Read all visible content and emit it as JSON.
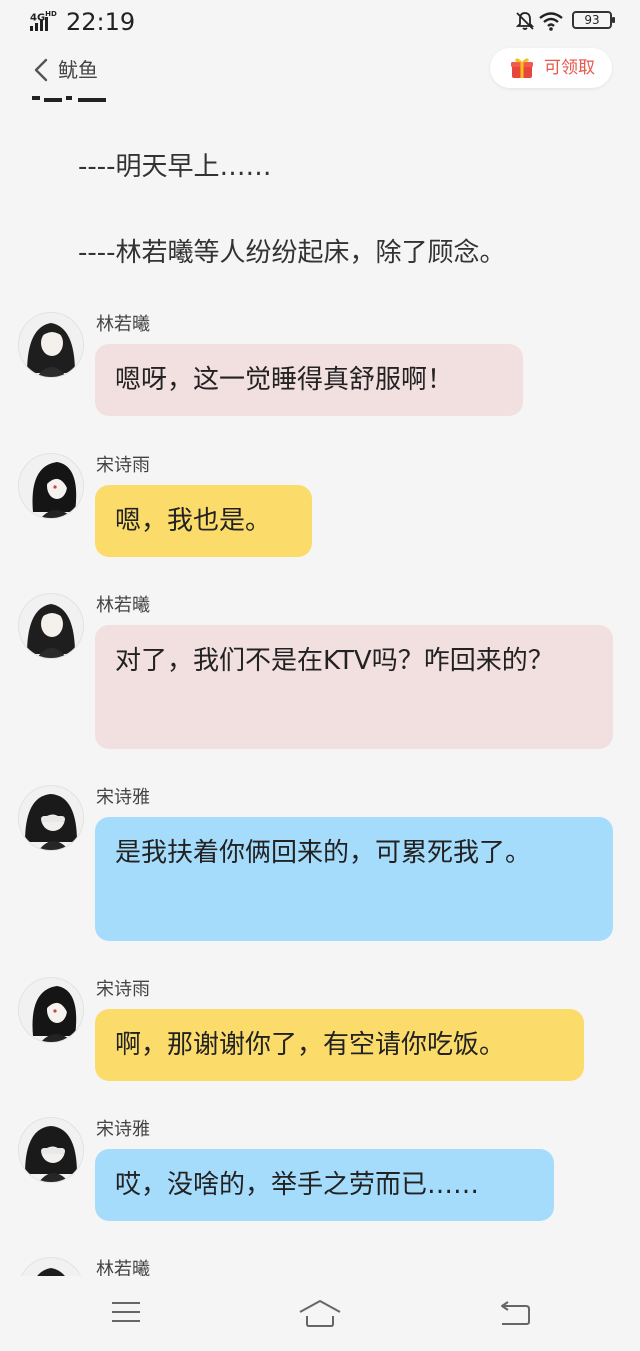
{
  "status": {
    "network": "4G",
    "network_sup": "HD",
    "time": "22:19",
    "battery": "93"
  },
  "nav": {
    "back_label": "鱿鱼",
    "reward_label": "可领取"
  },
  "narration": [
    "----明天早上……",
    "----林若曦等人纷纷起床，除了顾念。"
  ],
  "messages": [
    {
      "sender": "林若曦",
      "text": "嗯呀，这一觉睡得真舒服啊！",
      "color": "#f2dfe0"
    },
    {
      "sender": "宋诗雨",
      "text": "嗯，我也是。",
      "color": "#fbdc6b"
    },
    {
      "sender": "林若曦",
      "text": "对了，我们不是在KTV吗？咋回来的？",
      "color": "#f2dfe0"
    },
    {
      "sender": "宋诗雅",
      "text": "是我扶着你俩回来的，可累死我了。",
      "color": "#a6dcfb"
    },
    {
      "sender": "宋诗雨",
      "text": "啊，那谢谢你了，有空请你吃饭。",
      "color": "#fbdc6b"
    },
    {
      "sender": "宋诗雅",
      "text": "哎，没啥的，举手之劳而已……",
      "color": "#a6dcfb"
    },
    {
      "sender": "林若曦",
      "text": "",
      "color": "#f2dfe0"
    }
  ],
  "icons": {
    "bottom": [
      "menu-icon",
      "home-icon",
      "back-icon"
    ]
  }
}
